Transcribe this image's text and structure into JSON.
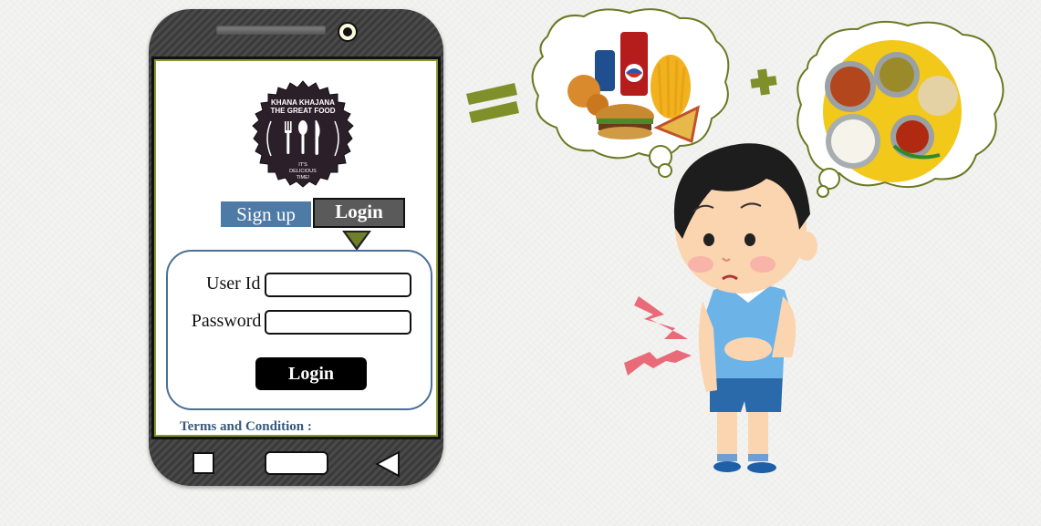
{
  "logo": {
    "line1": "KHANA KHAJANA",
    "line2": "THE GREAT FOOD",
    "tagline1": "IT'S",
    "tagline2": "DELICIOUS",
    "tagline3": "TIME!"
  },
  "tabs": {
    "signup_label": "Sign up",
    "login_label": "Login"
  },
  "form": {
    "user_label": "User Id :",
    "password_label": "Password :",
    "user_value": "",
    "password_value": "",
    "submit_label": "Login"
  },
  "footer": {
    "terms_label": "Terms and Condition :"
  },
  "nav": {
    "square_icon": "recent-apps-icon",
    "home_icon": "home-icon",
    "back_icon": "back-icon"
  },
  "colors": {
    "tab_signup": "#4e7aa6",
    "tab_login": "#5a5a5a",
    "card_border": "#4a6f95",
    "accent_olive": "#7f8f2a"
  }
}
